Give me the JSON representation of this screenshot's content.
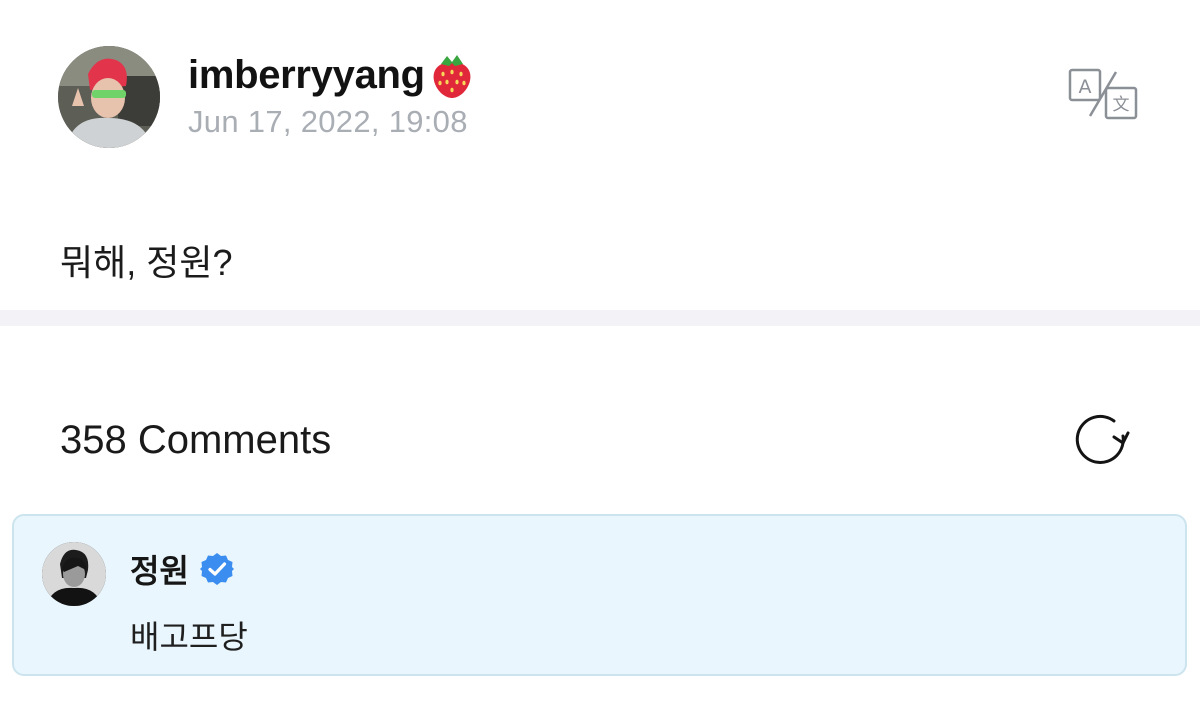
{
  "post": {
    "author": "imberryyang",
    "author_emoji_icon": "strawberry-icon",
    "date": "Jun 17, 2022, 19:08",
    "body": "뭐해, 정원?",
    "translate_icon": "translate-icon"
  },
  "comments": {
    "count_label": "358 Comments",
    "refresh_icon": "refresh-icon",
    "highlighted": {
      "author": "정원",
      "verified_icon": "verified-badge-icon",
      "text": "배고프당"
    }
  },
  "colors": {
    "highlight_bg": "#e9f6fd",
    "highlight_border": "#cce4ee",
    "verified": "#3b8ef0",
    "date_text": "#a9adb4",
    "divider": "#f3f3f7"
  }
}
